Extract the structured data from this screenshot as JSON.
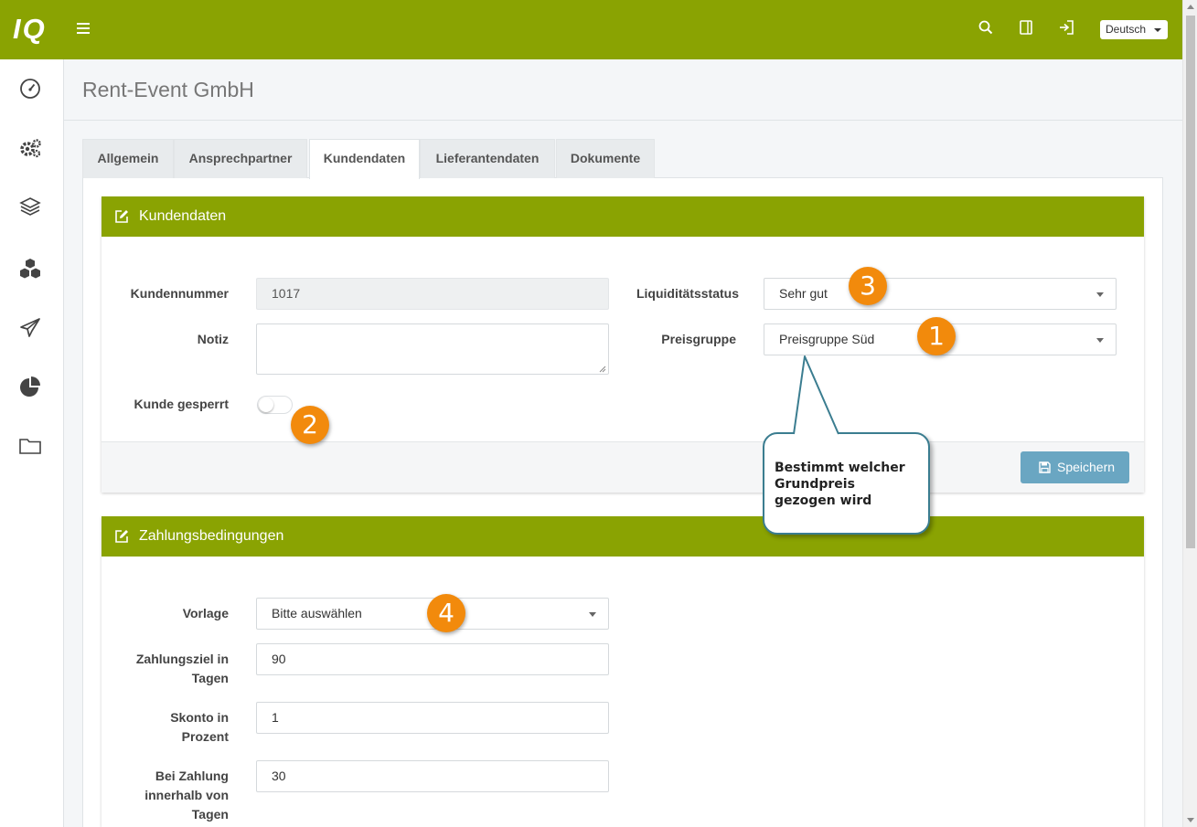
{
  "app": {
    "logo": "IQ",
    "language": "Deutsch"
  },
  "page": {
    "title": "Rent-Event GmbH"
  },
  "tabs": [
    {
      "label": "Allgemein"
    },
    {
      "label": "Ansprechpartner"
    },
    {
      "label": "Kundendaten"
    },
    {
      "label": "Lieferantendaten"
    },
    {
      "label": "Dokumente"
    }
  ],
  "kundendaten": {
    "title": "Kundendaten",
    "kundennummer_label": "Kundennummer",
    "kundennummer_value": "1017",
    "notiz_label": "Notiz",
    "notiz_value": "",
    "gesperrt_label": "Kunde gesperrt",
    "gesperrt_value": false,
    "liquiditaet_label": "Liquiditätsstatus",
    "liquiditaet_value": "Sehr gut",
    "preisgruppe_label": "Preisgruppe",
    "preisgruppe_value": "Preisgruppe Süd",
    "save_label": "Speichern"
  },
  "zahlung": {
    "title": "Zahlungsbedingungen",
    "vorlage_label": "Vorlage",
    "vorlage_value": "Bitte auswählen",
    "ziel_label_1": "Zahlungsziel in",
    "ziel_label_2": "Tagen",
    "ziel_value": "90",
    "skonto_label_1": "Skonto in",
    "skonto_label_2": "Prozent",
    "skonto_value": "1",
    "bei_label_1": "Bei Zahlung",
    "bei_label_2": "innerhalb von",
    "bei_label_3": "Tagen",
    "bei_value": "30"
  },
  "annotations": {
    "badge_1": "1",
    "badge_2": "2",
    "badge_3": "3",
    "badge_4": "4",
    "callout_line_1": "Bestimmt welcher",
    "callout_line_2": "Grundpreis",
    "callout_line_3": "gezogen wird"
  },
  "colors": {
    "brand": "#8aa302",
    "save_button": "#6aa6c2",
    "badge": "#f28a0c",
    "callout_border": "#3b7d90"
  }
}
